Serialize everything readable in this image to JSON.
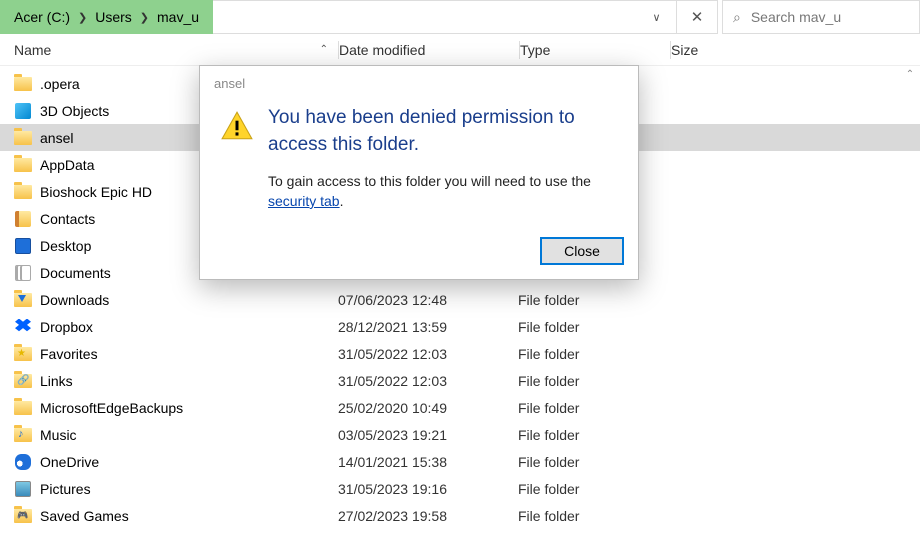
{
  "breadcrumb": {
    "b1": "Acer (C:)",
    "b2": "Users",
    "b3": "mav_u"
  },
  "search": {
    "placeholder": "Search mav_u"
  },
  "columns": {
    "name": "Name",
    "date": "Date modified",
    "type": "Type",
    "size": "Size"
  },
  "rows": [
    {
      "name": ".opera",
      "date": "",
      "type": "",
      "icon": "folder",
      "selected": false
    },
    {
      "name": "3D Objects",
      "date": "",
      "type": "",
      "icon": "3d",
      "selected": false
    },
    {
      "name": "ansel",
      "date": "",
      "type": "",
      "icon": "folder",
      "selected": true
    },
    {
      "name": "AppData",
      "date": "",
      "type": "",
      "icon": "folder",
      "selected": false
    },
    {
      "name": "Bioshock Epic HD",
      "date": "",
      "type": "",
      "icon": "folder",
      "selected": false
    },
    {
      "name": "Contacts",
      "date": "",
      "type": "",
      "icon": "contacts",
      "selected": false
    },
    {
      "name": "Desktop",
      "date": "",
      "type": "",
      "icon": "desktop",
      "selected": false
    },
    {
      "name": "Documents",
      "date": "",
      "type": "",
      "icon": "docs",
      "selected": false
    },
    {
      "name": "Downloads",
      "date": "07/06/2023 12:48",
      "type": "File folder",
      "icon": "downloads",
      "selected": false
    },
    {
      "name": "Dropbox",
      "date": "28/12/2021 13:59",
      "type": "File folder",
      "icon": "dropbox",
      "selected": false
    },
    {
      "name": "Favorites",
      "date": "31/05/2022 12:03",
      "type": "File folder",
      "icon": "favorites",
      "selected": false
    },
    {
      "name": "Links",
      "date": "31/05/2022 12:03",
      "type": "File folder",
      "icon": "links",
      "selected": false
    },
    {
      "name": "MicrosoftEdgeBackups",
      "date": "25/02/2020 10:49",
      "type": "File folder",
      "icon": "folder",
      "selected": false
    },
    {
      "name": "Music",
      "date": "03/05/2023 19:21",
      "type": "File folder",
      "icon": "music",
      "selected": false
    },
    {
      "name": "OneDrive",
      "date": "14/01/2021 15:38",
      "type": "File folder",
      "icon": "onedrive",
      "selected": false
    },
    {
      "name": "Pictures",
      "date": "31/05/2023 19:16",
      "type": "File folder",
      "icon": "pictures",
      "selected": false
    },
    {
      "name": "Saved Games",
      "date": "27/02/2023 19:58",
      "type": "File folder",
      "icon": "savedgames",
      "selected": false
    }
  ],
  "dialog": {
    "title": "ansel",
    "heading": "You have been denied permission to access this folder.",
    "body_pre": "To gain access to this folder you will need to use the ",
    "link": "security tab",
    "body_post": ".",
    "close": "Close"
  }
}
